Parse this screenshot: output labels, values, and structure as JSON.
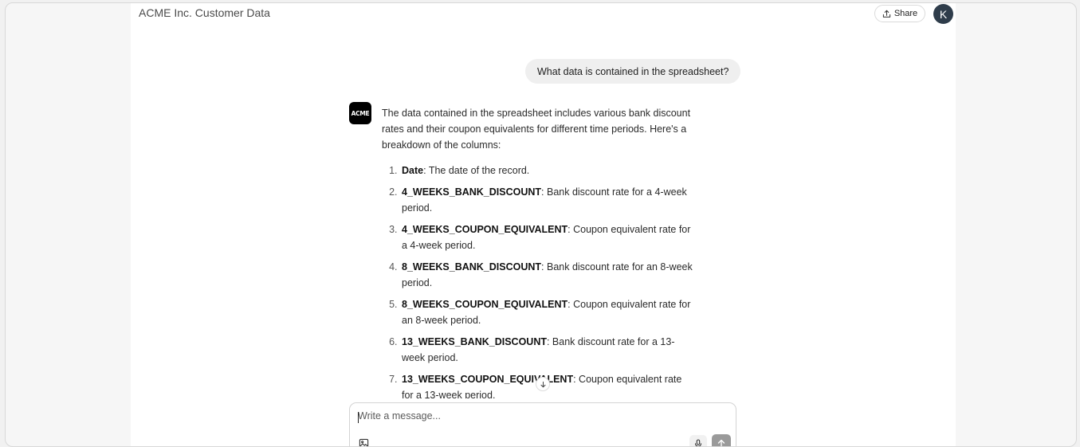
{
  "header": {
    "title": "ACME Inc. Customer Data",
    "share_label": "Share",
    "avatar_initial": "K"
  },
  "conversation": {
    "user_message": "What data is contained in the spreadsheet?",
    "assistant_logo_text": "ACME",
    "assistant_intro": "The data contained in the spreadsheet includes various bank discount rates and their coupon equivalents for different time periods. Here's a breakdown of the columns:",
    "columns": [
      {
        "name": "Date",
        "description": ": The date of the record."
      },
      {
        "name": "4_WEEKS_BANK_DISCOUNT",
        "description": ": Bank discount rate for a 4-week period."
      },
      {
        "name": "4_WEEKS_COUPON_EQUIVALENT",
        "description": ": Coupon equivalent rate for a 4-week period."
      },
      {
        "name": "8_WEEKS_BANK_DISCOUNT",
        "description": ": Bank discount rate for an 8-week period."
      },
      {
        "name": "8_WEEKS_COUPON_EQUIVALENT",
        "description": ": Coupon equivalent rate for an 8-week period."
      },
      {
        "name": "13_WEEKS_BANK_DISCOUNT",
        "description": ": Bank discount rate for a 13-week period."
      },
      {
        "name": "13_WEEKS_COUPON_EQUIVALENT",
        "description": ": Coupon equivalent rate for a 13-week period."
      }
    ]
  },
  "composer": {
    "placeholder": "Write a message...",
    "value": ""
  },
  "icons": {
    "share": "share-icon",
    "scroll_down": "arrow-down-icon",
    "attach": "image-attach-icon",
    "mic": "microphone-icon",
    "send": "arrow-up-icon"
  },
  "colors": {
    "logo_bg": "#000000",
    "avatar_bg": "#2f3d4b",
    "send_bg": "#9a9a9a",
    "user_bubble_bg": "#efefef"
  }
}
